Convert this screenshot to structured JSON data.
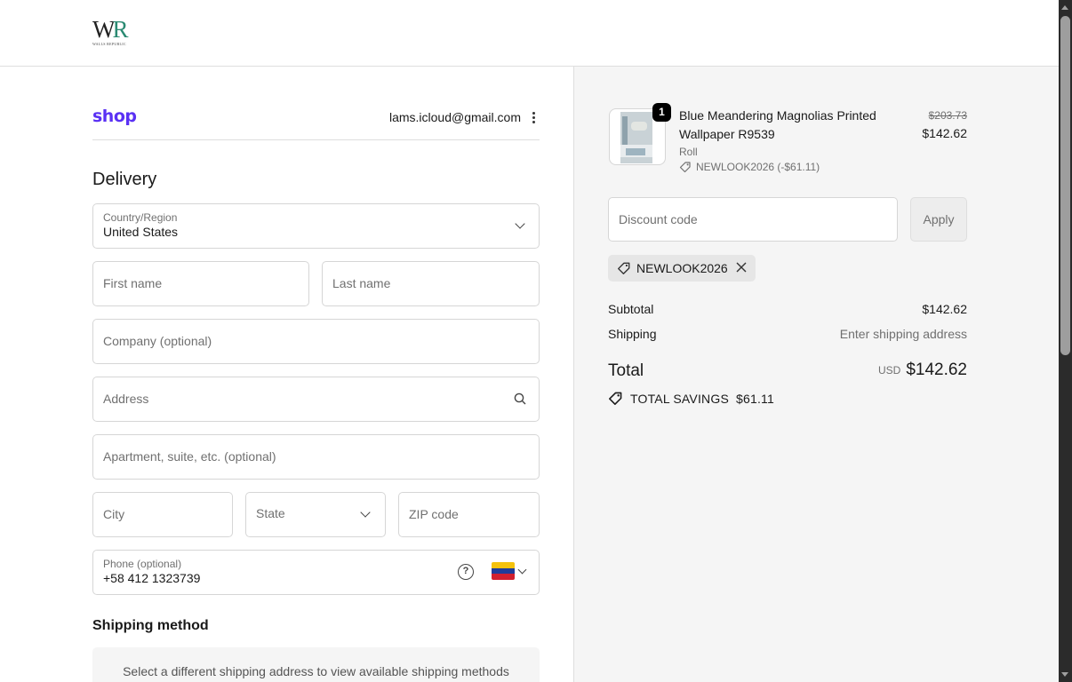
{
  "brand": {
    "logo_mark": "WR",
    "logo_sub": "WALLS REPUBLIC"
  },
  "shop": {
    "logo": "shop",
    "account_email": "lams.icloud@gmail.com"
  },
  "delivery": {
    "heading": "Delivery",
    "country": {
      "label": "Country/Region",
      "value": "United States"
    },
    "first_name": {
      "placeholder": "First name"
    },
    "last_name": {
      "placeholder": "Last name"
    },
    "company": {
      "placeholder": "Company (optional)"
    },
    "address": {
      "placeholder": "Address"
    },
    "apartment": {
      "placeholder": "Apartment, suite, etc. (optional)"
    },
    "city": {
      "placeholder": "City"
    },
    "state": {
      "placeholder": "State"
    },
    "zip": {
      "placeholder": "ZIP code"
    },
    "phone": {
      "label": "Phone (optional)",
      "value": "+58 412 1323739",
      "flag_colors": [
        "#f4c20d",
        "#1f3c9a",
        "#d1202f"
      ]
    }
  },
  "shipping_method": {
    "heading": "Shipping method",
    "message": "Select a different shipping address to view available shipping methods"
  },
  "order": {
    "item": {
      "quantity": "1",
      "name": "Blue Meandering Magnolias Printed Wallpaper R9539",
      "variant": "Roll",
      "discount": "NEWLOOK2026 (-$61.11)",
      "original_price": "$203.73",
      "price": "$142.62"
    },
    "discount_code": {
      "placeholder": "Discount code",
      "apply_label": "Apply"
    },
    "applied_code": "NEWLOOK2026",
    "subtotal": {
      "label": "Subtotal",
      "value": "$142.62"
    },
    "shipping": {
      "label": "Shipping",
      "value": "Enter shipping address"
    },
    "total": {
      "label": "Total",
      "currency": "USD",
      "value": "$142.62"
    },
    "savings": {
      "label": "TOTAL SAVINGS",
      "value": "$61.11"
    }
  },
  "colors": {
    "shop_brand": "#5a31f4",
    "logo_accent": "#2a8a72",
    "summary_bg": "#f5f5f5"
  }
}
